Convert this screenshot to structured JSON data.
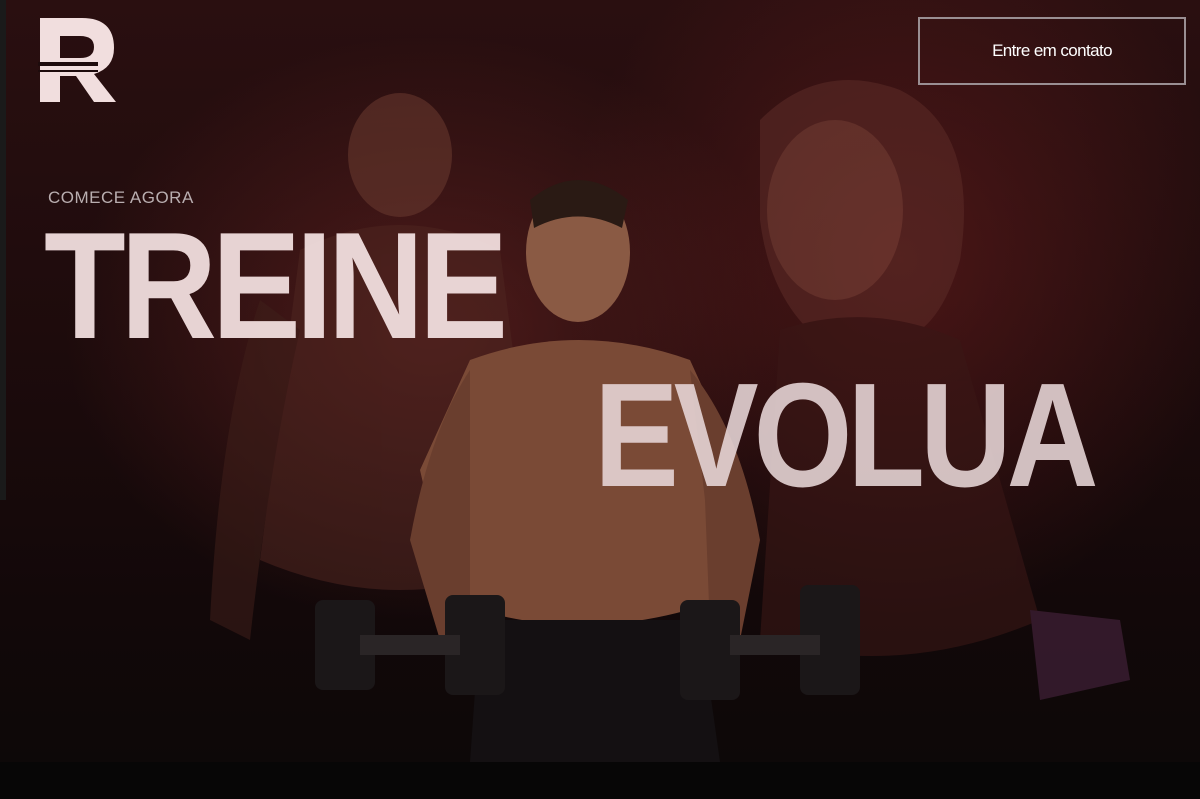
{
  "header": {
    "logo_letter": "R",
    "contact_button_label": "Entre em contato"
  },
  "hero": {
    "eyebrow": "COMECE AGORA",
    "headline_primary": "TREINE",
    "headline_secondary": "EVOLUA"
  },
  "colors": {
    "background": "#1d0b0c",
    "headline_text": "#f1dede",
    "button_border": "#9a8f93"
  }
}
